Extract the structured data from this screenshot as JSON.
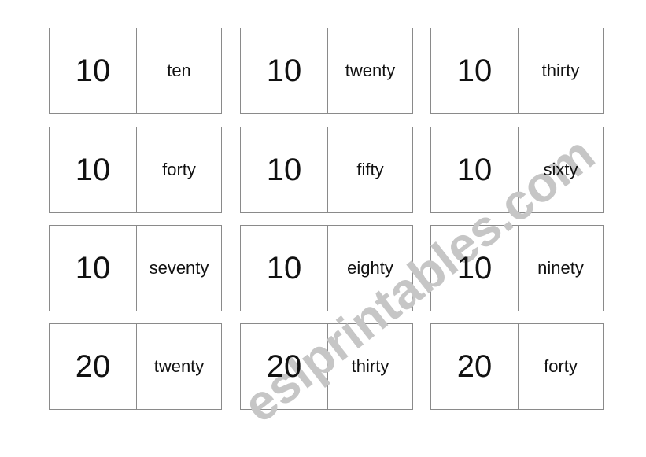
{
  "cards": [
    {
      "number": "10",
      "word": "ten"
    },
    {
      "number": "10",
      "word": "twenty"
    },
    {
      "number": "10",
      "word": "thirty"
    },
    {
      "number": "10",
      "word": "forty"
    },
    {
      "number": "10",
      "word": "fifty"
    },
    {
      "number": "10",
      "word": "sixty"
    },
    {
      "number": "10",
      "word": "seventy"
    },
    {
      "number": "10",
      "word": "eighty"
    },
    {
      "number": "10",
      "word": "ninety"
    },
    {
      "number": "20",
      "word": "twenty"
    },
    {
      "number": "20",
      "word": "thirty"
    },
    {
      "number": "20",
      "word": "forty"
    }
  ],
  "watermark": "eslprintables.com",
  "colors": {
    "watermark": "#c6c6c6",
    "border": "#8a8a8a"
  }
}
